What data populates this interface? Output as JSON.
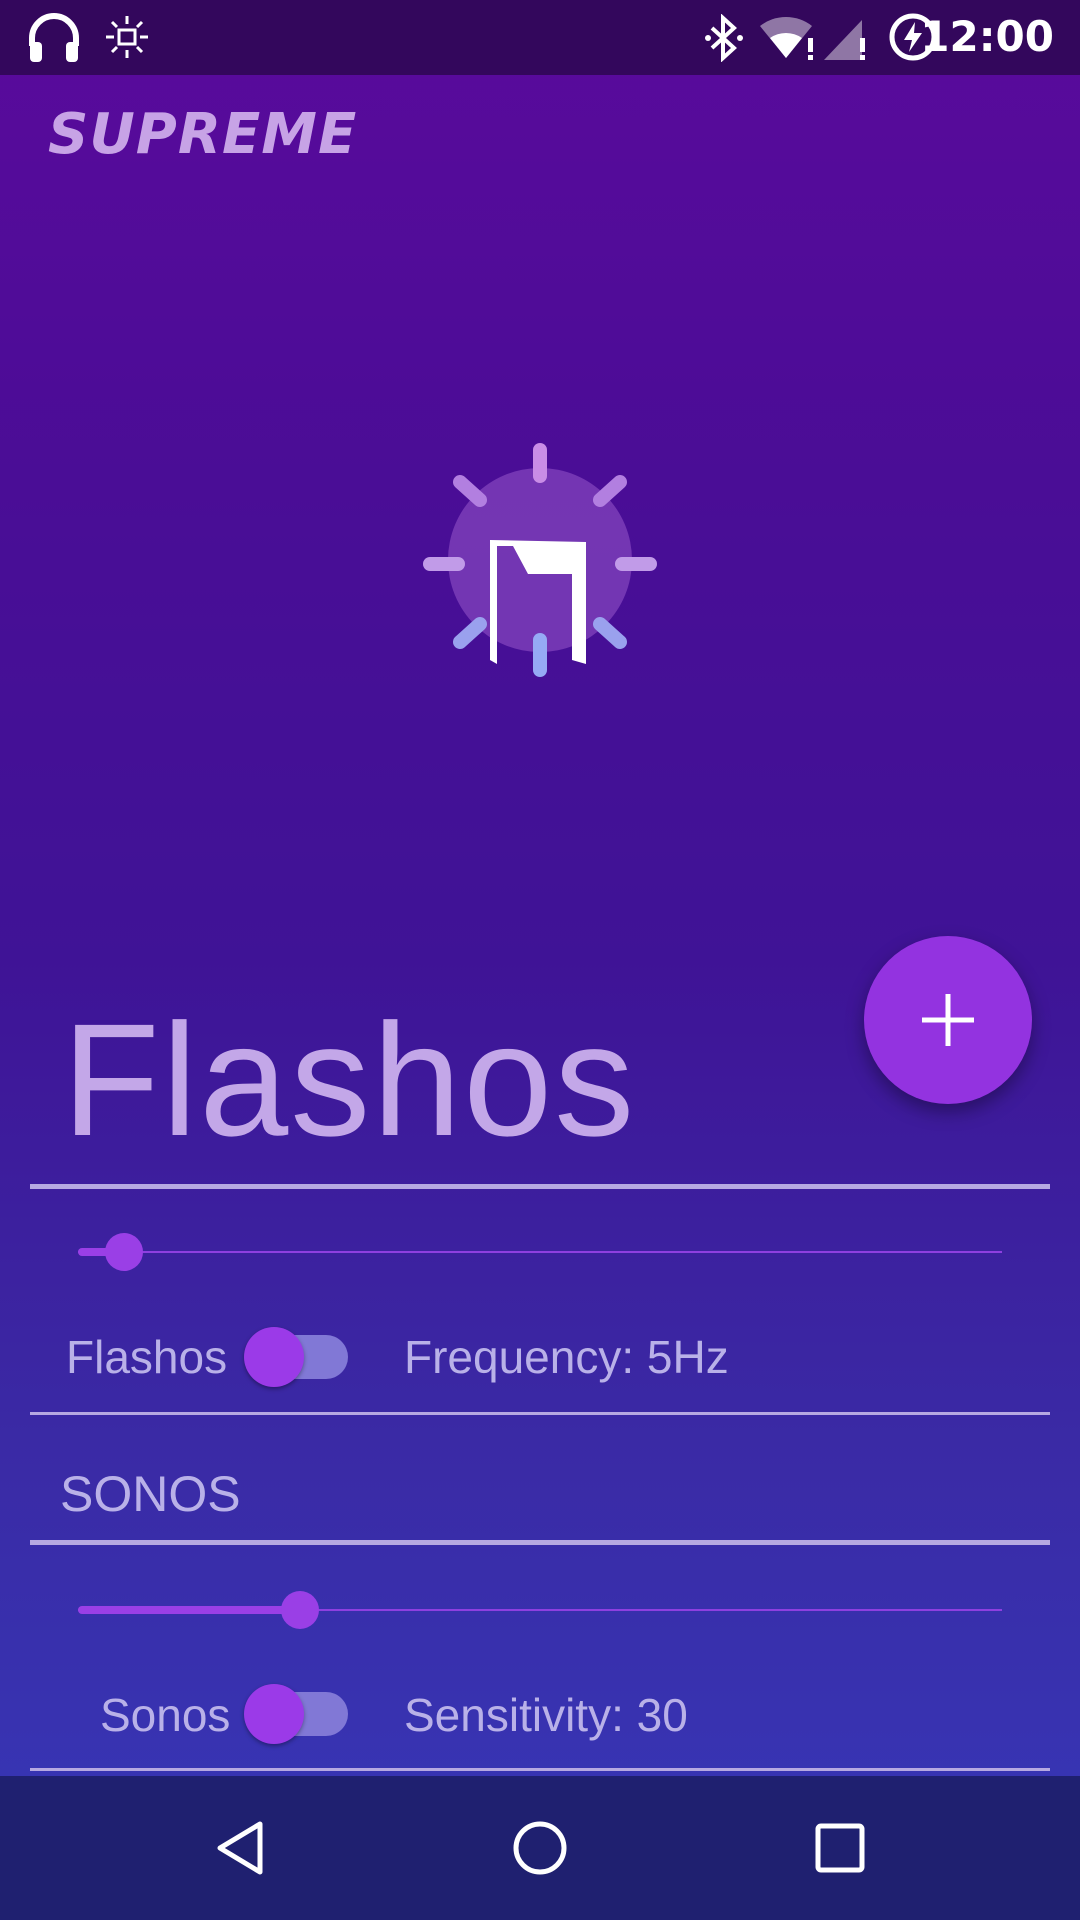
{
  "status_bar": {
    "time": "12:00",
    "left_icons": [
      "headphones-icon",
      "brightness-icon"
    ],
    "right_icons": [
      "bluetooth-icon",
      "wifi-alert-icon",
      "signal-alert-icon",
      "battery-charging-icon"
    ]
  },
  "app": {
    "title": "SUPREME"
  },
  "fab": {
    "icon": "plus-icon"
  },
  "flashos": {
    "heading": "Flashos",
    "slider_value": 0.05,
    "toggle_label": "Flashos",
    "toggle_on": false,
    "frequency_text": "Frequency: 5Hz"
  },
  "sonos": {
    "section_label": "SONOS",
    "slider_value": 0.24,
    "toggle_label": "Sonos",
    "toggle_on": false,
    "sensitivity_text": "Sensitivity: 30"
  },
  "nav": {
    "back_icon": "back-triangle-icon",
    "home_icon": "home-circle-icon",
    "recents_icon": "recents-square-icon"
  },
  "colors": {
    "accent": "#9333e0",
    "status_bar": "#33075c",
    "nav_bar": "#1f2070"
  }
}
